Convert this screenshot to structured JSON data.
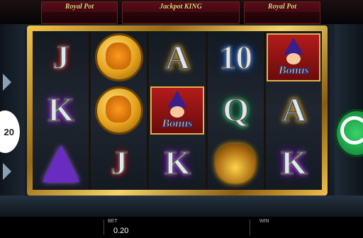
{
  "jackpots": [
    {
      "name": "Royal Pot"
    },
    {
      "name": "Jackpot KING"
    },
    {
      "name": "Royal Pot"
    }
  ],
  "line_button": {
    "value": "20"
  },
  "reels": [
    [
      {
        "type": "letter",
        "text": "J",
        "glow": "red"
      },
      {
        "type": "letter",
        "text": "K",
        "glow": "purple"
      },
      {
        "type": "wizard-hat-icon"
      }
    ],
    [
      {
        "type": "coin-icon"
      },
      {
        "type": "coin-icon"
      },
      {
        "type": "letter",
        "text": "J",
        "glow": "red"
      }
    ],
    [
      {
        "type": "letter",
        "text": "A",
        "glow": "gold"
      },
      {
        "type": "bonus",
        "text": "Bonus"
      },
      {
        "type": "letter",
        "text": "K",
        "glow": "purple"
      }
    ],
    [
      {
        "type": "letter",
        "text": "10",
        "glow": "blue"
      },
      {
        "type": "letter",
        "text": "Q",
        "glow": "green"
      },
      {
        "type": "gold-sack-icon"
      }
    ],
    [
      {
        "type": "bonus",
        "text": "Bonus"
      },
      {
        "type": "letter",
        "text": "A",
        "glow": "gold"
      },
      {
        "type": "letter",
        "text": "K",
        "glow": "purple"
      }
    ]
  ],
  "bottom_bar": {
    "bet_label": "BET",
    "bet_value": "0.20",
    "win_label": "WIN",
    "win_value": ""
  },
  "colors": {
    "spin_button": "#1a9a43",
    "frame_gold": "#f2c44b",
    "jackpot_red": "#5a0d18"
  }
}
